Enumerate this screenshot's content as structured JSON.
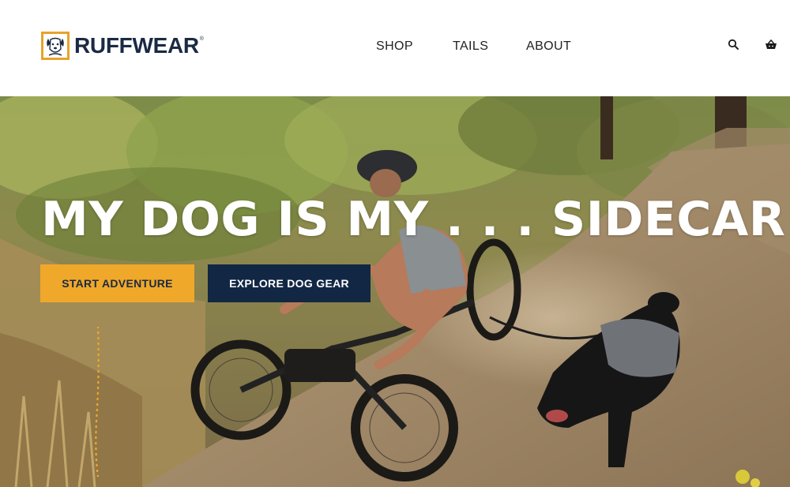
{
  "header": {
    "logo_text": "RUFFWEAR",
    "logo_reg": "®",
    "nav": [
      {
        "label": "SHOP"
      },
      {
        "label": "TAILS"
      },
      {
        "label": "ABOUT"
      }
    ],
    "icons": {
      "search": "search-icon",
      "cart": "basket-icon"
    }
  },
  "hero": {
    "heading": "MY DOG IS MY . . . SIDECAR",
    "buttons": {
      "start": "START ADVENTURE",
      "explore": "EXPLORE DOG GEAR"
    },
    "image": "trail-rider-with-dog-photo"
  },
  "colors": {
    "brand_navy": "#112744",
    "brand_orange": "#f0a82a",
    "logo_navy": "#1a2a44",
    "nav_text": "#222222",
    "hero_text": "#ffffff"
  }
}
